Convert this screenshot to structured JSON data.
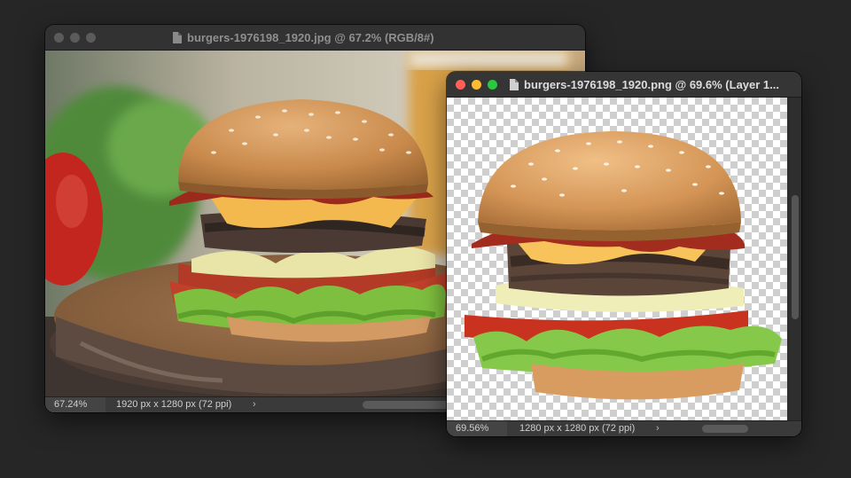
{
  "window_back": {
    "title": "burgers-1976198_1920.jpg @ 67.2% (RGB/8#)",
    "zoom": "67.24%",
    "dimensions": "1920 px x 1280 px (72 ppi)",
    "arrow": "›"
  },
  "window_front": {
    "title": "burgers-1976198_1920.png @ 69.6% (Layer 1...",
    "zoom": "69.56%",
    "dimensions": "1280 px x 1280 px (72 ppi)",
    "arrow": "›"
  },
  "colors": {
    "close": "#ff5f57",
    "minimize": "#febc2e",
    "zoom": "#28c840",
    "app_background": "#262626"
  },
  "icons": [
    "document-icon",
    "close-icon",
    "minimize-icon",
    "zoom-icon"
  ]
}
